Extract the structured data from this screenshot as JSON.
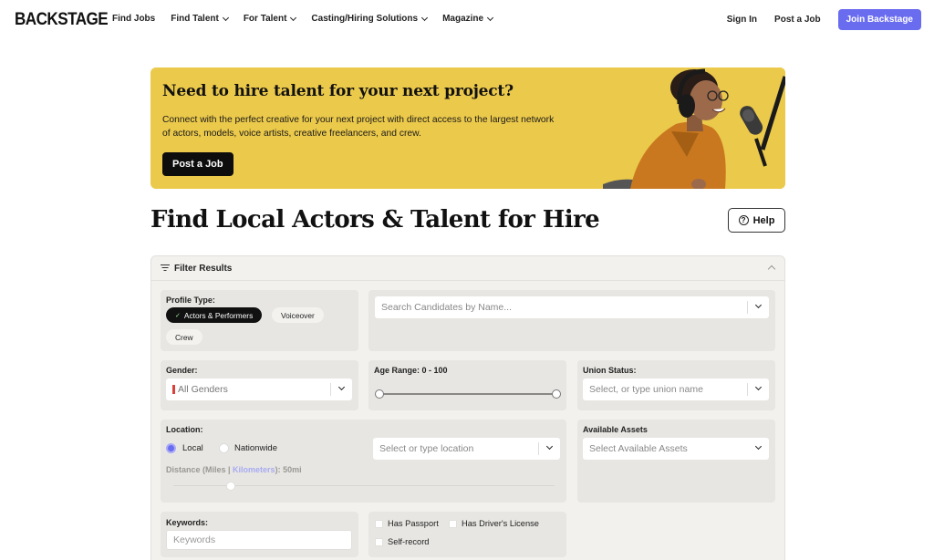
{
  "nav": {
    "logo": "BACKSTAGE",
    "links": [
      {
        "label": "Find Jobs",
        "dropdown": false
      },
      {
        "label": "Find Talent",
        "dropdown": true
      },
      {
        "label": "For Talent",
        "dropdown": true
      },
      {
        "label": "Casting/Hiring Solutions",
        "dropdown": true
      },
      {
        "label": "Magazine",
        "dropdown": true
      }
    ],
    "sign_in": "Sign In",
    "post_job": "Post a Job",
    "join": "Join Backstage"
  },
  "banner": {
    "title": "Need to hire talent for your next project?",
    "text": "Connect with the perfect creative for your next project with direct access to the largest network of actors, models, voice artists, creative freelancers, and crew.",
    "button": "Post a Job",
    "image_alt": "woman-with-headphones-and-microphone",
    "bg_color": "#ebc94a"
  },
  "page": {
    "title": "Find Local Actors & Talent for Hire",
    "help": "Help"
  },
  "filters": {
    "header": "Filter Results",
    "profile_type": {
      "label": "Profile Type:",
      "options": [
        {
          "label": "Actors & Performers",
          "selected": true
        },
        {
          "label": "Voiceover",
          "selected": false
        },
        {
          "label": "Crew",
          "selected": false
        }
      ]
    },
    "search": {
      "placeholder": "Search Candidates by Name..."
    },
    "gender": {
      "label": "Gender:",
      "value": "All Genders"
    },
    "age_range": {
      "label": "Age Range: 0 - 100",
      "min": 0,
      "max": 100
    },
    "union": {
      "label": "Union Status:",
      "placeholder": "Select, or type union name"
    },
    "location": {
      "label": "Location:",
      "options": [
        {
          "label": "Local",
          "selected": true
        },
        {
          "label": "Nationwide",
          "selected": false
        }
      ],
      "placeholder": "Select or type location",
      "distance_prefix": "Distance (Miles | ",
      "distance_link": "Kilometers",
      "distance_suffix": "): 50mi",
      "distance_value": 50,
      "distance_fraction": 0.15
    },
    "assets": {
      "label": "Available Assets",
      "placeholder": "Select Available Assets"
    },
    "keywords": {
      "label": "Keywords:",
      "placeholder": "Keywords"
    },
    "checkboxes": [
      {
        "label": "Has Passport",
        "checked": false
      },
      {
        "label": "Has Driver's License",
        "checked": false
      },
      {
        "label": "Self-record",
        "checked": false
      }
    ],
    "accent_color": "#6a6cf0"
  }
}
